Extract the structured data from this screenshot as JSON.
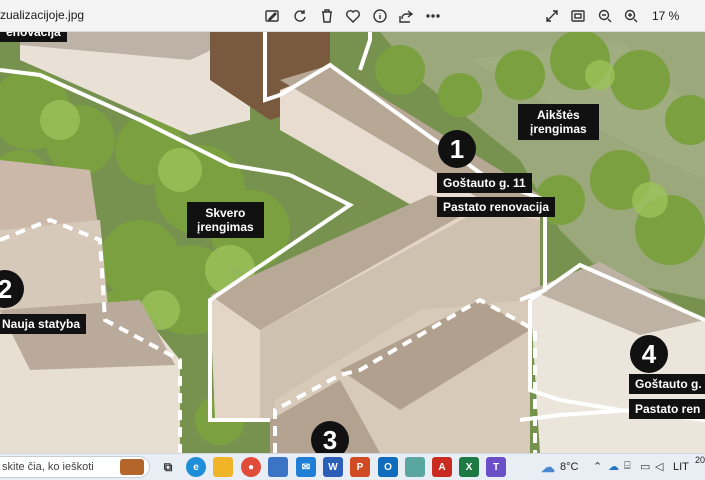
{
  "toolbar": {
    "filename": "zualizacijoje.jpg",
    "zoom_level": "17 %",
    "icons": [
      "edit-icon",
      "rotate-icon",
      "delete-icon",
      "favorite-icon",
      "info-icon",
      "share-icon",
      "more-icon",
      "fullscreen-icon",
      "fit-icon",
      "zoom-out-icon",
      "zoom-in-icon"
    ]
  },
  "labels": {
    "renovacija_top": "enovacija",
    "aikstes_line1": "Aikštės",
    "aikstes_line2": "įrengimas",
    "skvero_line1": "Skvero",
    "skvero_line2": "įrengimas",
    "gostauto11": "Goštauto g. 11",
    "pastato_renovacija": "Pastato renovacija",
    "nauja_statyba": "Nauja statyba",
    "gostauto_right": "Goštauto g.",
    "pastato_ren_right": "Pastato ren"
  },
  "markers": {
    "m1": "1",
    "m2": "2",
    "m3": "3",
    "m4": "4"
  },
  "taskbar": {
    "search_placeholder": "skite čia, ko ieškoti",
    "weather": "8°C",
    "language": "LIT",
    "clock_partial": "20"
  }
}
